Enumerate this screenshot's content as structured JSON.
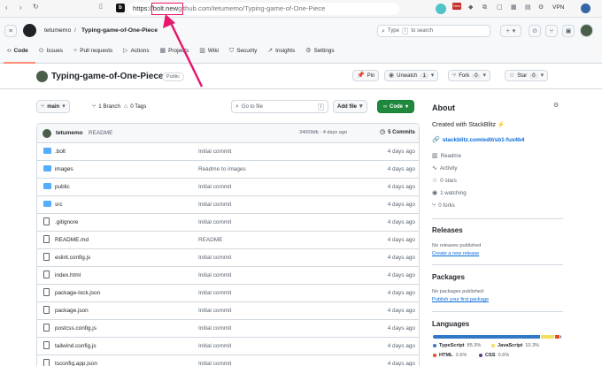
{
  "browser": {
    "url_prefix": "https://",
    "url_highlight": "bolt.new",
    "url_rest": "github.com/tetumemo/Typing-game-of-One-Piece",
    "vpn": "VPN",
    "new_badge": "New",
    "accent": "#e8186d"
  },
  "header": {
    "owner": "tetumemo",
    "slash": "/",
    "repo": "Typing-game-of-One-Piece",
    "search_placeholder_pre": "Type",
    "search_key": "/",
    "search_placeholder_post": "to search",
    "tabs": [
      {
        "label": "Code"
      },
      {
        "label": "Issues"
      },
      {
        "label": "Pull requests"
      },
      {
        "label": "Actions"
      },
      {
        "label": "Projects"
      },
      {
        "label": "Wiki"
      },
      {
        "label": "Security"
      },
      {
        "label": "Insights"
      },
      {
        "label": "Settings"
      }
    ]
  },
  "repo": {
    "title": "Typing-game-of-One-Piece",
    "visibility": "Public",
    "pin": "Pin",
    "unwatch": "Unwatch",
    "unwatch_count": "1",
    "fork": "Fork",
    "fork_count": "0",
    "star": "Star",
    "star_count": "0",
    "branch": "main",
    "branches": "1 Branch",
    "tags": "0 Tags",
    "goto_placeholder": "Go to file",
    "goto_key": "t",
    "add_file": "Add file",
    "code_button": "Code",
    "green": "#1f883d"
  },
  "commit": {
    "user": "tetumemo",
    "message": "README",
    "hash_time": "34009db · 4 days ago",
    "commits": "5 Commits"
  },
  "files": [
    {
      "name": ".bolt",
      "type": "folder",
      "commit": "Initial commit",
      "date": "4 days ago"
    },
    {
      "name": "images",
      "type": "folder",
      "commit": "Readme to images",
      "date": "4 days ago"
    },
    {
      "name": "public",
      "type": "folder",
      "commit": "Initial commit",
      "date": "4 days ago"
    },
    {
      "name": "src",
      "type": "folder",
      "commit": "Initial commit",
      "date": "4 days ago"
    },
    {
      "name": ".gitignore",
      "type": "file",
      "commit": "Initial commit",
      "date": "4 days ago"
    },
    {
      "name": "README.md",
      "type": "file",
      "commit": "README",
      "date": "4 days ago"
    },
    {
      "name": "eslint.config.js",
      "type": "file",
      "commit": "Initial commit",
      "date": "4 days ago"
    },
    {
      "name": "index.html",
      "type": "file",
      "commit": "Initial commit",
      "date": "4 days ago"
    },
    {
      "name": "package-lock.json",
      "type": "file",
      "commit": "Initial commit",
      "date": "4 days ago"
    },
    {
      "name": "package.json",
      "type": "file",
      "commit": "Initial commit",
      "date": "4 days ago"
    },
    {
      "name": "postcss.config.js",
      "type": "file",
      "commit": "Initial commit",
      "date": "4 days ago"
    },
    {
      "name": "tailwind.config.js",
      "type": "file",
      "commit": "Initial commit",
      "date": "4 days ago"
    },
    {
      "name": "tsconfig.app.json",
      "type": "file",
      "commit": "Initial commit",
      "date": "4 days ago"
    }
  ],
  "about": {
    "title": "About",
    "description": "Created with StackBlitz ⚡",
    "link": "stackblitz.com/edit/sb1-fux4b4",
    "readme": "Readme",
    "activity": "Activity",
    "stars": "0 stars",
    "watching": "1 watching",
    "forks": "0 forks"
  },
  "releases": {
    "title": "Releases",
    "none": "No releases published",
    "create": "Create a new release"
  },
  "packages": {
    "title": "Packages",
    "none": "No packages published",
    "publish": "Publish your first package"
  },
  "languages": {
    "title": "Languages",
    "items": [
      {
        "name": "TypeScript",
        "pct": "85.3%",
        "value": 85.3,
        "color": "#3178c6"
      },
      {
        "name": "JavaScript",
        "pct": "10.3%",
        "value": 10.3,
        "color": "#f1e05a"
      },
      {
        "name": "HTML",
        "pct": "3.6%",
        "value": 3.6,
        "color": "#e34c26"
      },
      {
        "name": "CSS",
        "pct": "0.6%",
        "value": 0.6,
        "color": "#563d7c"
      }
    ]
  }
}
